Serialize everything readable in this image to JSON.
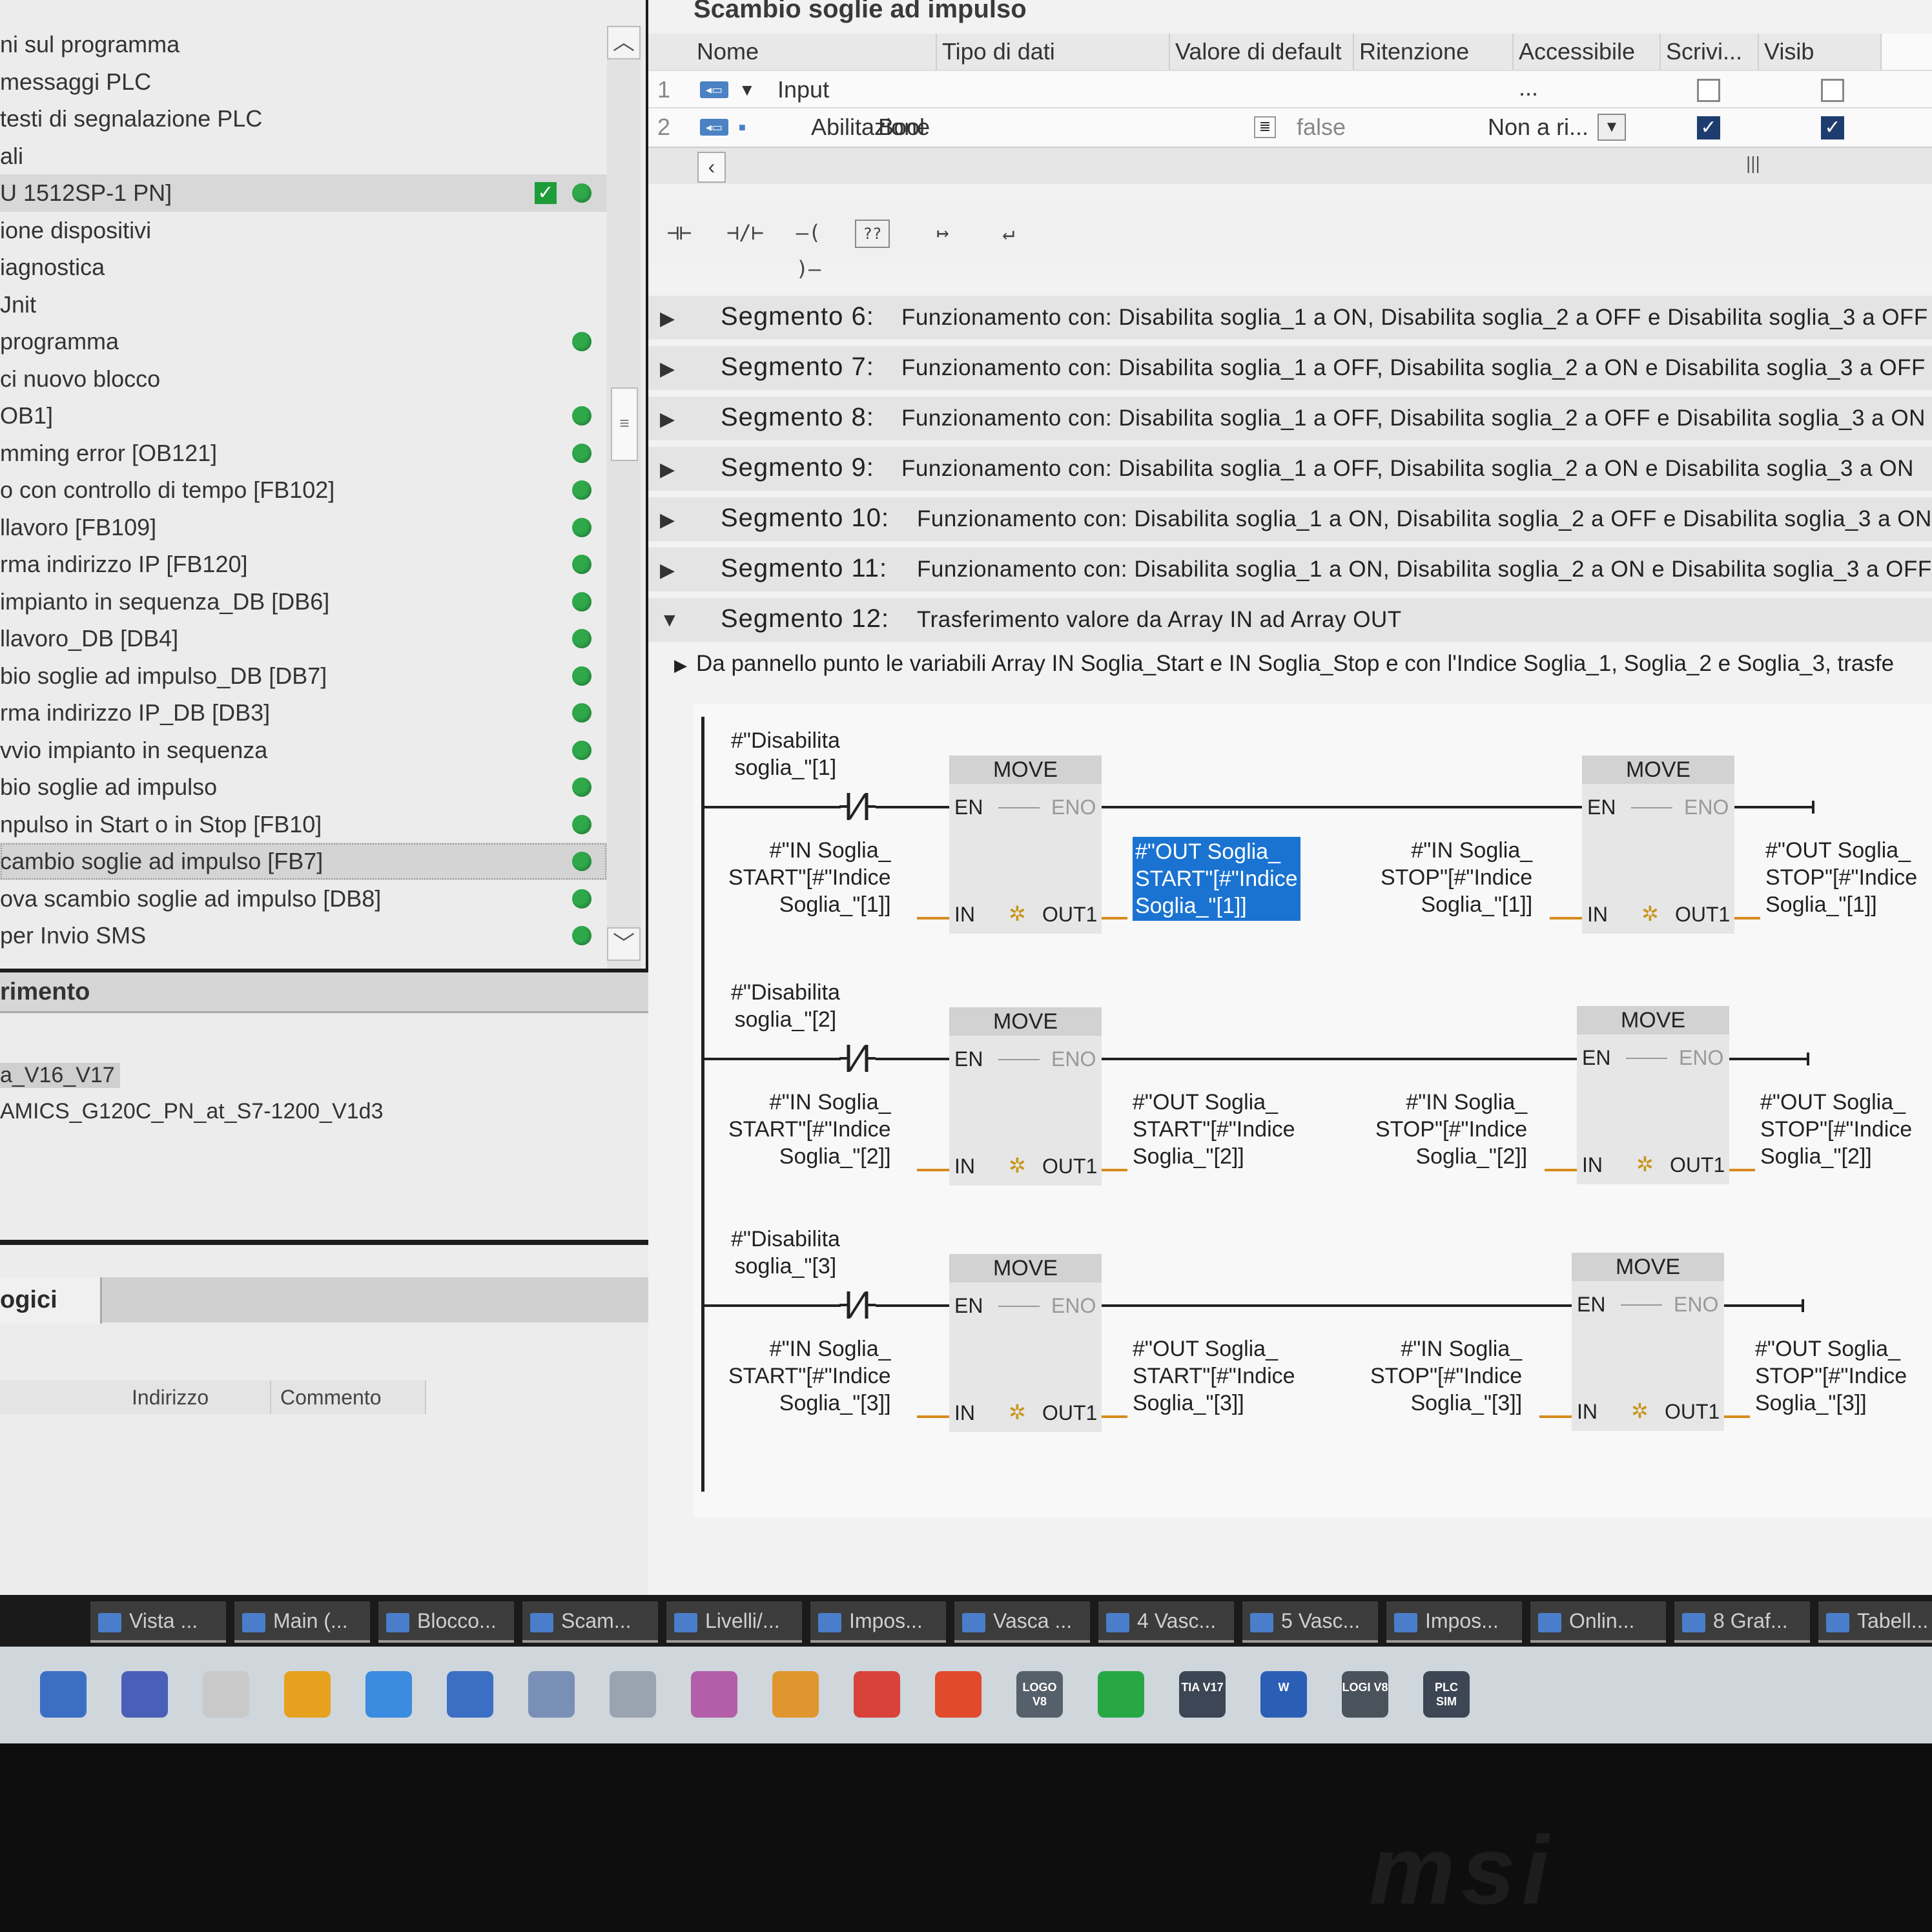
{
  "tree": {
    "items": [
      {
        "label": "ni sul programma",
        "status": ""
      },
      {
        "label": "messaggi PLC",
        "status": ""
      },
      {
        "label": "testi di segnalazione PLC",
        "status": ""
      },
      {
        "label": "ali",
        "status": ""
      },
      {
        "label": "U 1512SP-1 PN]",
        "status": "check"
      },
      {
        "label": "ione dispositivi",
        "status": ""
      },
      {
        "label": "iagnostica",
        "status": ""
      },
      {
        "label": "Jnit",
        "status": ""
      },
      {
        "label": "programma",
        "status": "ok"
      },
      {
        "label": "ci nuovo blocco",
        "status": ""
      },
      {
        "label": "OB1]",
        "status": "ok"
      },
      {
        "label": "mming error [OB121]",
        "status": "ok"
      },
      {
        "label": "o con controllo di tempo [FB102]",
        "status": "ok"
      },
      {
        "label": "llavoro [FB109]",
        "status": "ok"
      },
      {
        "label": "rma indirizzo IP [FB120]",
        "status": "ok"
      },
      {
        "label": "impianto in sequenza_DB [DB6]",
        "status": "ok"
      },
      {
        "label": "llavoro_DB [DB4]",
        "status": "ok"
      },
      {
        "label": "bio soglie ad impulso_DB [DB7]",
        "status": "ok"
      },
      {
        "label": "rma indirizzo IP_DB [DB3]",
        "status": "ok"
      },
      {
        "label": "vvio impianto in sequenza",
        "status": "ok"
      },
      {
        "label": "bio soglie ad impulso",
        "status": "ok"
      },
      {
        "label": "npulso in Start o in Stop [FB10]",
        "status": "ok"
      },
      {
        "label": "cambio soglie ad impulso [FB7]",
        "status": "ok"
      },
      {
        "label": "ova scambio soglie ad impulso [DB8]",
        "status": "ok"
      },
      {
        "label": " per Invio SMS",
        "status": "ok"
      }
    ]
  },
  "reference": {
    "title": "rimento",
    "item1": "a_V16_V17",
    "item2": "AMICS_G120C_PN_at_S7-1200_V1d3"
  },
  "tags": {
    "tab": "ogici",
    "col_address": "Indirizzo",
    "col_comment": "Commento"
  },
  "interface": {
    "title": "Scambio soglie ad impulso",
    "headers": [
      "Nome",
      "Tipo di dati",
      "Valore di default",
      "Ritenzione",
      "Accessibile ...",
      "Scrivi...",
      "Visib"
    ],
    "rows": [
      {
        "num": "1",
        "name": "Input",
        "type": "",
        "default": "",
        "retention": "",
        "accessible": false,
        "writable": false
      },
      {
        "num": "2",
        "name": "Abilitazione",
        "type": "Bool",
        "default": "false",
        "retention": "Non a ri...",
        "accessible": true,
        "writable": true
      }
    ]
  },
  "toolbar": {
    "no_contact": "⊣⊢",
    "nc_contact": "⊣/⊢",
    "coil": "–( )–",
    "empty_box": "??",
    "open_branch": "↦",
    "close_branch": "↵"
  },
  "segments": [
    {
      "label": "Segmento 6:",
      "desc": "Funzionamento con: Disabilita soglia_1 a ON, Disabilita soglia_2 a OFF e Disabilita soglia_3 a OFF",
      "expanded": false
    },
    {
      "label": "Segmento 7:",
      "desc": "Funzionamento con: Disabilita soglia_1 a OFF, Disabilita soglia_2 a ON e Disabilita soglia_3 a OFF",
      "expanded": false
    },
    {
      "label": "Segmento 8:",
      "desc": "Funzionamento con: Disabilita soglia_1 a OFF, Disabilita soglia_2 a OFF e Disabilita soglia_3 a ON",
      "expanded": false
    },
    {
      "label": "Segmento 9:",
      "desc": "Funzionamento con: Disabilita soglia_1 a OFF, Disabilita soglia_2 a ON e Disabilita soglia_3 a ON",
      "expanded": false
    },
    {
      "label": "Segmento 10:",
      "desc": "Funzionamento con: Disabilita soglia_1 a ON, Disabilita soglia_2 a OFF e Disabilita soglia_3 a ON",
      "expanded": false
    },
    {
      "label": "Segmento 11:",
      "desc": "Funzionamento con: Disabilita soglia_1 a ON, Disabilita soglia_2 a ON e Disabilita soglia_3 a OFF",
      "expanded": false
    },
    {
      "label": "Segmento 12:",
      "desc": "Trasferimento valore da Array IN ad Array OUT",
      "expanded": true
    }
  ],
  "seg12_comment": "Da pannello punto le variabili Array IN Soglia_Start e IN Soglia_Stop e con l'Indice Soglia_1, Soglia_2 e Soglia_3, trasfe",
  "ladder": {
    "block_title": "MOVE",
    "pin_en": "EN",
    "pin_eno": "ENO",
    "pin_in": "IN",
    "pin_out": "OUT1",
    "rungs": [
      {
        "contact": "#\"Disabilita\nsoglia_\"[1]",
        "in_start": "#\"IN Soglia_\nSTART\"[#\"Indice\nSoglia_\"[1]]",
        "out_start": "#\"OUT Soglia_\nSTART\"[#\"Indice\nSoglia_\"[1]]",
        "in_stop": "#\"IN Soglia_\nSTOP\"[#\"Indice\nSoglia_\"[1]]",
        "out_stop": "#\"OUT Soglia_\nSTOP\"[#\"Indice\nSoglia_\"[1]]"
      },
      {
        "contact": "#\"Disabilita\nsoglia_\"[2]",
        "in_start": "#\"IN Soglia_\nSTART\"[#\"Indice\nSoglia_\"[2]]",
        "out_start": "#\"OUT Soglia_\nSTART\"[#\"Indice\nSoglia_\"[2]]",
        "in_stop": "#\"IN Soglia_\nSTOP\"[#\"Indice\nSoglia_\"[2]]",
        "out_stop": "#\"OUT Soglia_\nSTOP\"[#\"Indice\nSoglia_\"[2]]"
      },
      {
        "contact": "#\"Disabilita\nsoglia_\"[3]",
        "in_start": "#\"IN Soglia_\nSTART\"[#\"Indice\nSoglia_\"[3]]",
        "out_start": "#\"OUT Soglia_\nSTART\"[#\"Indice\nSoglia_\"[3]]",
        "in_stop": "#\"IN Soglia_\nSTOP\"[#\"Indice\nSoglia_\"[3]]",
        "out_stop": "#\"OUT Soglia_\nSTOP\"[#\"Indice\nSoglia_\"[3]]"
      }
    ]
  },
  "taskbar": [
    "Vista ...",
    "Main (...",
    "Blocco...",
    "Scam...",
    "Livelli/...",
    "Impos...",
    "Vasca ...",
    "4 Vasc...",
    "5 Vasc...",
    "Impos...",
    "Onlin...",
    "8 Graf...",
    "Tabell..."
  ],
  "dock": [
    "LOGO V8",
    "TIA V17",
    "W",
    "LOGI V8",
    "PLC SIM"
  ],
  "colors": {
    "accent": "#1a73d1",
    "status_ok": "#2fa84a",
    "wire_orange": "#d88a1e"
  },
  "bezel_logo": "msi"
}
